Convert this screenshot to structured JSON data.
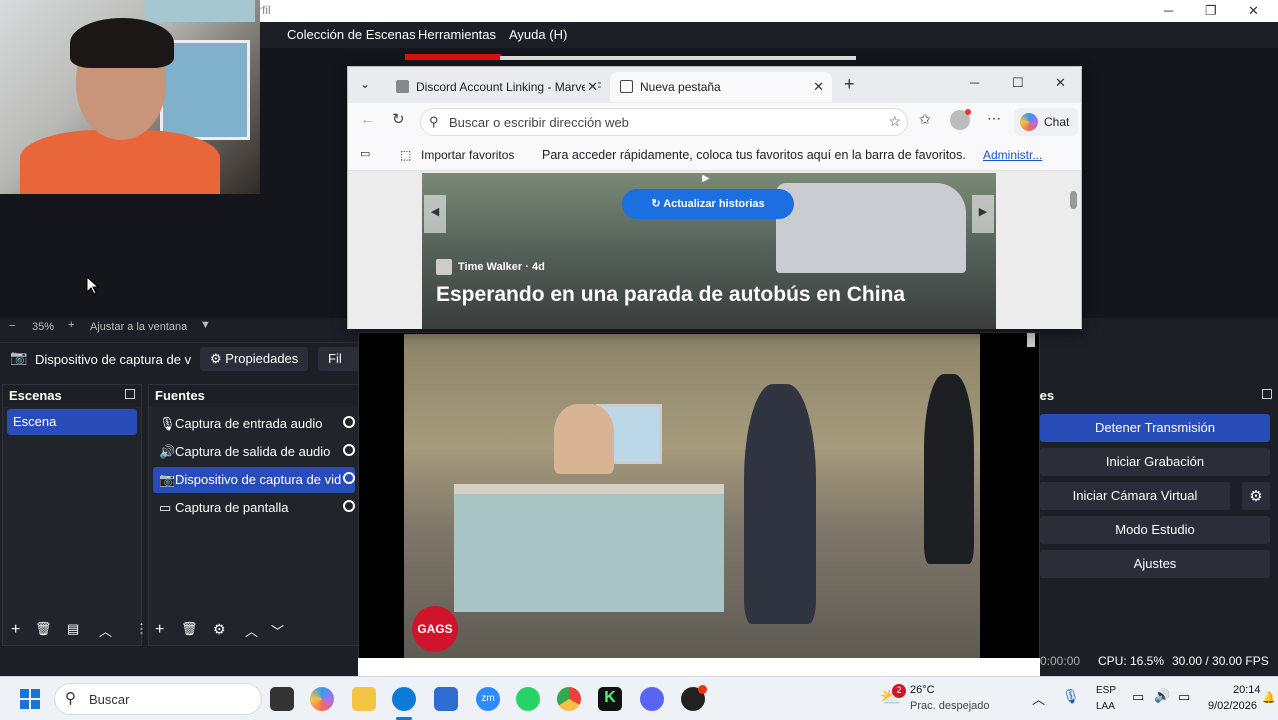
{
  "obs": {
    "title_fragment": "rfil",
    "menu": [
      "Colección de Escenas",
      "Herramientas",
      "Ayuda (H)"
    ],
    "zoom": {
      "minus": "−",
      "value": "35%",
      "plus": "+",
      "fit_label": "Ajustar a la ventana"
    },
    "source_toolbar": {
      "selected_source": "Dispositivo de captura de v",
      "properties": "Propiedades",
      "filters": "Fil"
    },
    "scenes": {
      "title": "Escenas",
      "items": [
        "Escena"
      ]
    },
    "sources": {
      "title": "Fuentes",
      "items": [
        {
          "label": "Captura de entrada audio",
          "icon": "mic-icon"
        },
        {
          "label": "Captura de salida de audio",
          "icon": "speaker-icon"
        },
        {
          "label": "Dispositivo de captura de vid",
          "icon": "camera-icon",
          "selected": true
        },
        {
          "label": "Captura de pantalla",
          "icon": "monitor-icon"
        }
      ]
    },
    "controls": {
      "title_fragment": "les",
      "buttons": [
        "Detener Transmisión",
        "Iniciar Grabación",
        "Iniciar Cámara Virtual",
        "Modo Estudio",
        "Ajustes"
      ]
    },
    "status": {
      "time": "0:00:00",
      "cpu": "CPU: 16.5%",
      "fps": "30.00 / 30.00 FPS"
    }
  },
  "video": {
    "logo_text": "GAGS"
  },
  "browser": {
    "tabs": [
      {
        "label": "Discord Account Linking - Marvel F",
        "active": false
      },
      {
        "label": "Nueva pestaña",
        "active": true
      }
    ],
    "address_placeholder": "Buscar o escribir dirección web",
    "chat_label": "Chat",
    "favorites": {
      "import": "Importar favoritos",
      "hint": "Para acceder rápidamente, coloca tus favoritos aquí en la barra de favoritos.",
      "manage": "Administr..."
    },
    "news": {
      "refresh": "Actualizar historias",
      "author": "Time Walker · 4d",
      "title": "Esperando en una parada de autobús en China"
    }
  },
  "taskbar": {
    "search": "Buscar",
    "weather": {
      "temp": "26°C",
      "condition": "Prac. despejado",
      "badge": "2"
    },
    "language": {
      "line1": "ESP",
      "line2": "LAA"
    },
    "clock": {
      "time": "20:14",
      "date": "9/02/2026"
    },
    "colors": {
      "edge": "#0c7bd6",
      "chrome": "#e9443a",
      "discord": "#5865f2",
      "whatsapp": "#25d366",
      "zoom": "#2d8cff"
    }
  }
}
